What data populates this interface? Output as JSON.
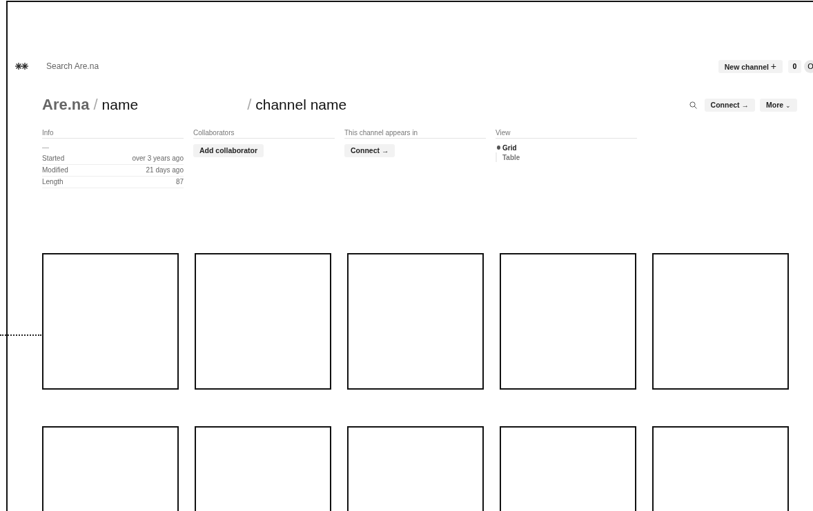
{
  "header": {
    "search": {
      "placeholder": "Search Are.na"
    },
    "new_channel": "New channel",
    "new_channel_icon": "+",
    "count": "0",
    "avatar": "O"
  },
  "breadcrumb": {
    "owner": "Are.na",
    "user": "name",
    "channel": "channel name",
    "separator": "/"
  },
  "actions": {
    "connect": "Connect",
    "connect_icon": "→",
    "more": "More",
    "more_icon": "⌄"
  },
  "info": {
    "title": "Info",
    "description": "—",
    "rows": [
      {
        "label": "Started",
        "value": "over 3 years ago"
      },
      {
        "label": "Modified",
        "value": "21 days ago"
      },
      {
        "label": "Length",
        "value": "87"
      }
    ]
  },
  "collaborators": {
    "title": "Collaborators",
    "button": "Add collaborator"
  },
  "appears_in": {
    "title": "This channel appears in",
    "button": "Connect",
    "button_icon": "→"
  },
  "view": {
    "title": "View",
    "options": [
      {
        "label": "Grid",
        "selected": true
      },
      {
        "label": "Table",
        "selected": false
      }
    ]
  },
  "blocks": [
    {
      "kind": "empty"
    },
    {
      "kind": "empty"
    },
    {
      "kind": "empty"
    },
    {
      "kind": "empty"
    },
    {
      "kind": "empty"
    },
    {
      "kind": "empty"
    },
    {
      "kind": "empty"
    },
    {
      "kind": "empty"
    },
    {
      "kind": "empty"
    },
    {
      "kind": "empty"
    }
  ],
  "leader": {
    "kind": "dotted"
  }
}
